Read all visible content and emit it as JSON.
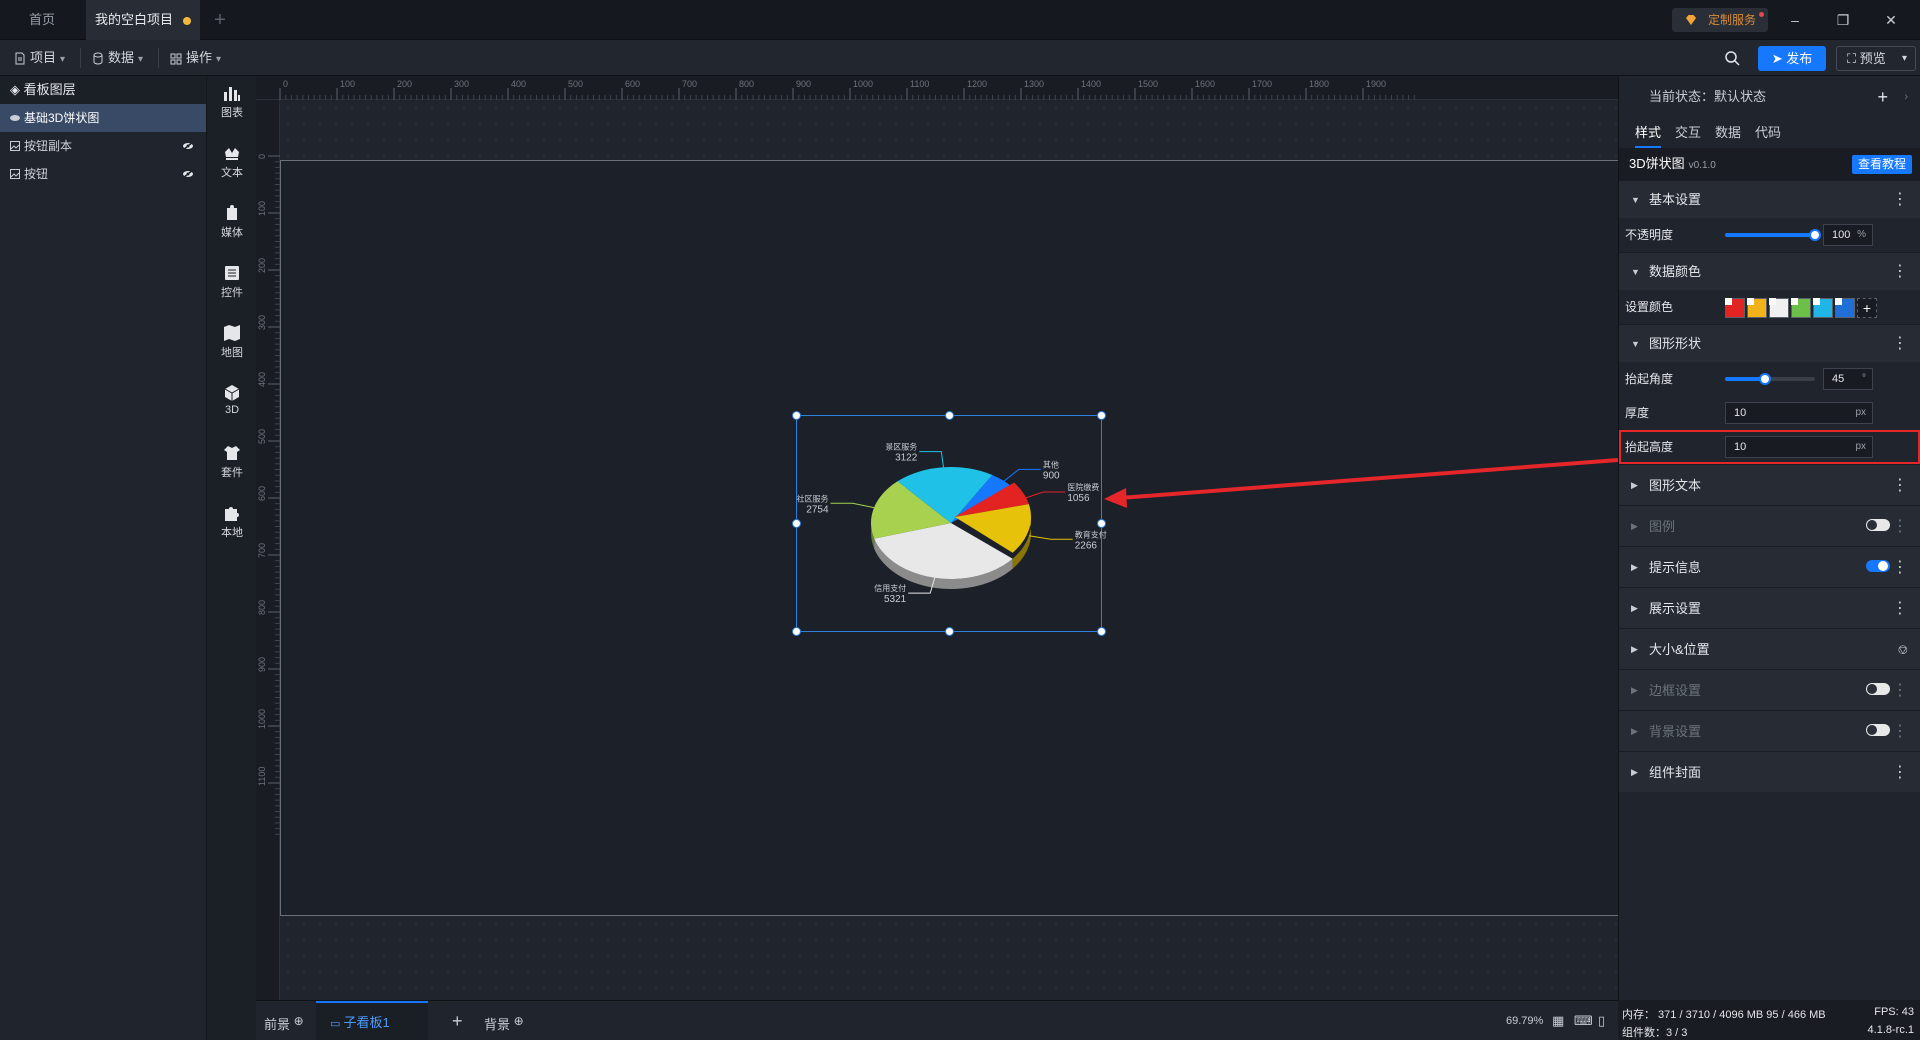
{
  "tabs": {
    "home": "首页",
    "project": "我的空白项目"
  },
  "header": {
    "custom_service": "定制服务",
    "publish": "发布",
    "preview": "预览"
  },
  "toolbar": {
    "project": "项目",
    "data": "数据",
    "operate": "操作"
  },
  "layers": {
    "title": "看板图层",
    "items": [
      {
        "label": "基础3D饼状图"
      },
      {
        "label": "按钮副本"
      },
      {
        "label": "按钮"
      }
    ]
  },
  "rail": [
    "图表",
    "文本",
    "媒体",
    "控件",
    "地图",
    "3D",
    "套件",
    "本地"
  ],
  "ruler": {
    "top": [
      "0",
      "100",
      "200",
      "300",
      "400",
      "500",
      "600",
      "700",
      "800",
      "900",
      "1000",
      "1100",
      "1200",
      "1300",
      "1400",
      "1500",
      "1600",
      "1700",
      "1800",
      "1900"
    ],
    "left": [
      "0",
      "100",
      "200",
      "300",
      "400",
      "500",
      "600",
      "700",
      "800",
      "900",
      "1000",
      "1100"
    ]
  },
  "chart_data": {
    "type": "pie",
    "is_3d": true,
    "labels": [
      "信用支付",
      "社区服务",
      "景区服务",
      "其他",
      "医院缴费",
      "教育支付"
    ],
    "values": [
      5321,
      2754,
      3122,
      900,
      1056,
      2266
    ],
    "colors": [
      "#e8e8e8",
      "#a8d14f",
      "#1fc1e6",
      "#1677ff",
      "#e32222",
      "#e6c20a"
    ]
  },
  "bottom": {
    "front": "前景",
    "sub_board": "子看板1",
    "background": "背景",
    "zoom": "69.79%"
  },
  "panel": {
    "state": "当前状态：默认状态",
    "tabs": [
      "样式",
      "交互",
      "数据",
      "代码"
    ],
    "component": "3D饼状图",
    "version": "v0.1.0",
    "tutorial": "查看教程",
    "basic": "基本设置",
    "opacity_label": "不透明度",
    "opacity": "100",
    "opacity_unit": "%",
    "data_color": "数据颜色",
    "set_color": "设置颜色",
    "swatches": [
      "#e32222",
      "#f2b21a",
      "#f0f0f0",
      "#6cc04a",
      "#1fb5e6",
      "#1f6fd6"
    ],
    "shape": "图形形状",
    "angle_label": "抬起角度",
    "angle": "45",
    "angle_unit": "°",
    "thickness_label": "厚度",
    "thickness": "10",
    "thickness_unit": "px",
    "lift_label": "抬起高度",
    "lift": "10",
    "lift_unit": "px",
    "sections": [
      "图形文本",
      "图例",
      "提示信息",
      "展示设置",
      "大小&位置",
      "边框设置",
      "背景设置",
      "组件封面"
    ]
  },
  "status": {
    "mem": "内存： 371 / 3710 / 4096 MB  95 / 466 MB",
    "fps": "FPS: 43",
    "count": "组件数：3 / 3",
    "version": "4.1.8-rc.1"
  }
}
